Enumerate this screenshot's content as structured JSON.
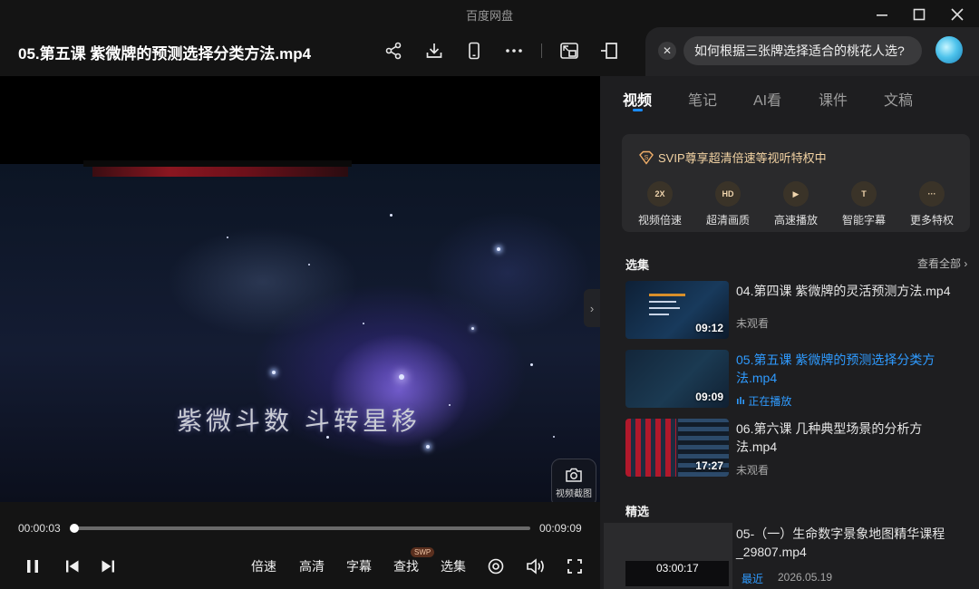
{
  "app": {
    "name": "百度网盘"
  },
  "header": {
    "file_title": "05.第五课 紫微牌的预测选择分类方法.mp4",
    "tools": [
      "share-icon",
      "download-icon",
      "phone-icon",
      "more-icon",
      "pip-icon",
      "collapse-icon"
    ]
  },
  "ask": {
    "question": "如何根据三张牌选择适合的桃花人选?"
  },
  "video": {
    "caption": "紫微斗数  斗转星移",
    "screenshot_label": "视频截图",
    "current_time": "00:00:03",
    "total_time": "00:09:09",
    "progress_fraction": 0.005
  },
  "controls": {
    "speed": "倍速",
    "quality": "高清",
    "subtitle": "字幕",
    "search": "查找",
    "search_badge": "SWP",
    "episodes": "选集"
  },
  "panel": {
    "tabs": [
      "视频",
      "笔记",
      "AI看",
      "课件",
      "文稿"
    ],
    "active_tab": "视频",
    "svip": {
      "header": "SVIP尊享超清倍速等视听特权中",
      "perks": [
        {
          "label": "视频倍速",
          "icon": "2X"
        },
        {
          "label": "超清画质",
          "icon": "HD"
        },
        {
          "label": "高速播放",
          "icon": "▶"
        },
        {
          "label": "智能字幕",
          "icon": "T"
        },
        {
          "label": "更多特权",
          "icon": "···"
        }
      ]
    },
    "episodes_title": "选集",
    "see_all": "查看全部",
    "episodes": [
      {
        "title": "04.第四课 紫微牌的灵活预测方法.mp4",
        "duration": "09:12",
        "status": "未观看",
        "playing": false
      },
      {
        "title": "05.第五课 紫微牌的预测选择分类方法.mp4",
        "duration": "09:09",
        "status": "正在播放",
        "playing": true
      },
      {
        "title": "06.第六课 几种典型场景的分析方法.mp4",
        "duration": "17:27",
        "status": "未观看",
        "playing": false
      }
    ],
    "featured_title": "精选",
    "featured": {
      "title": "05-（一）生命数字景象地图精华课程_29807.mp4",
      "duration": "03:00:17",
      "tag": "最近",
      "date": "2026.05.19"
    }
  },
  "colors": {
    "accent": "#1a8cff",
    "playing": "#2f9bff",
    "svip": "#f3d3a3"
  }
}
